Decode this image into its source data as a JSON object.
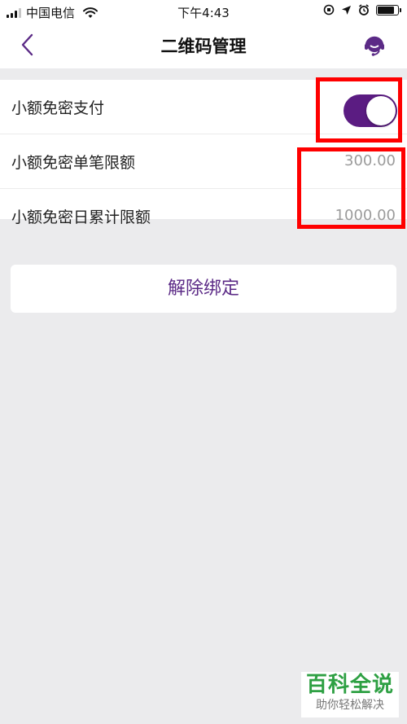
{
  "status_bar": {
    "carrier": "中国电信",
    "time": "下午4:43",
    "battery_level": 0.85,
    "signal_bars": 3
  },
  "nav": {
    "title": "二维码管理",
    "back_icon": "chevron-left-icon",
    "support_icon": "customer-service-icon",
    "accent_color": "#5b2a86"
  },
  "settings": {
    "small_amount_pay": {
      "label": "小额免密支付",
      "enabled": true
    },
    "single_limit": {
      "label": "小额免密单笔限额",
      "value": "300.00"
    },
    "daily_limit": {
      "label": "小额免密日累计限额",
      "value": "1000.00"
    }
  },
  "unbind": {
    "label": "解除绑定"
  },
  "watermark": {
    "title": "百科全说",
    "subtitle": "助你轻松解决"
  },
  "colors": {
    "toggle_on": "#5b1c82",
    "annotation": "#ff0000",
    "background": "#ebebed"
  }
}
